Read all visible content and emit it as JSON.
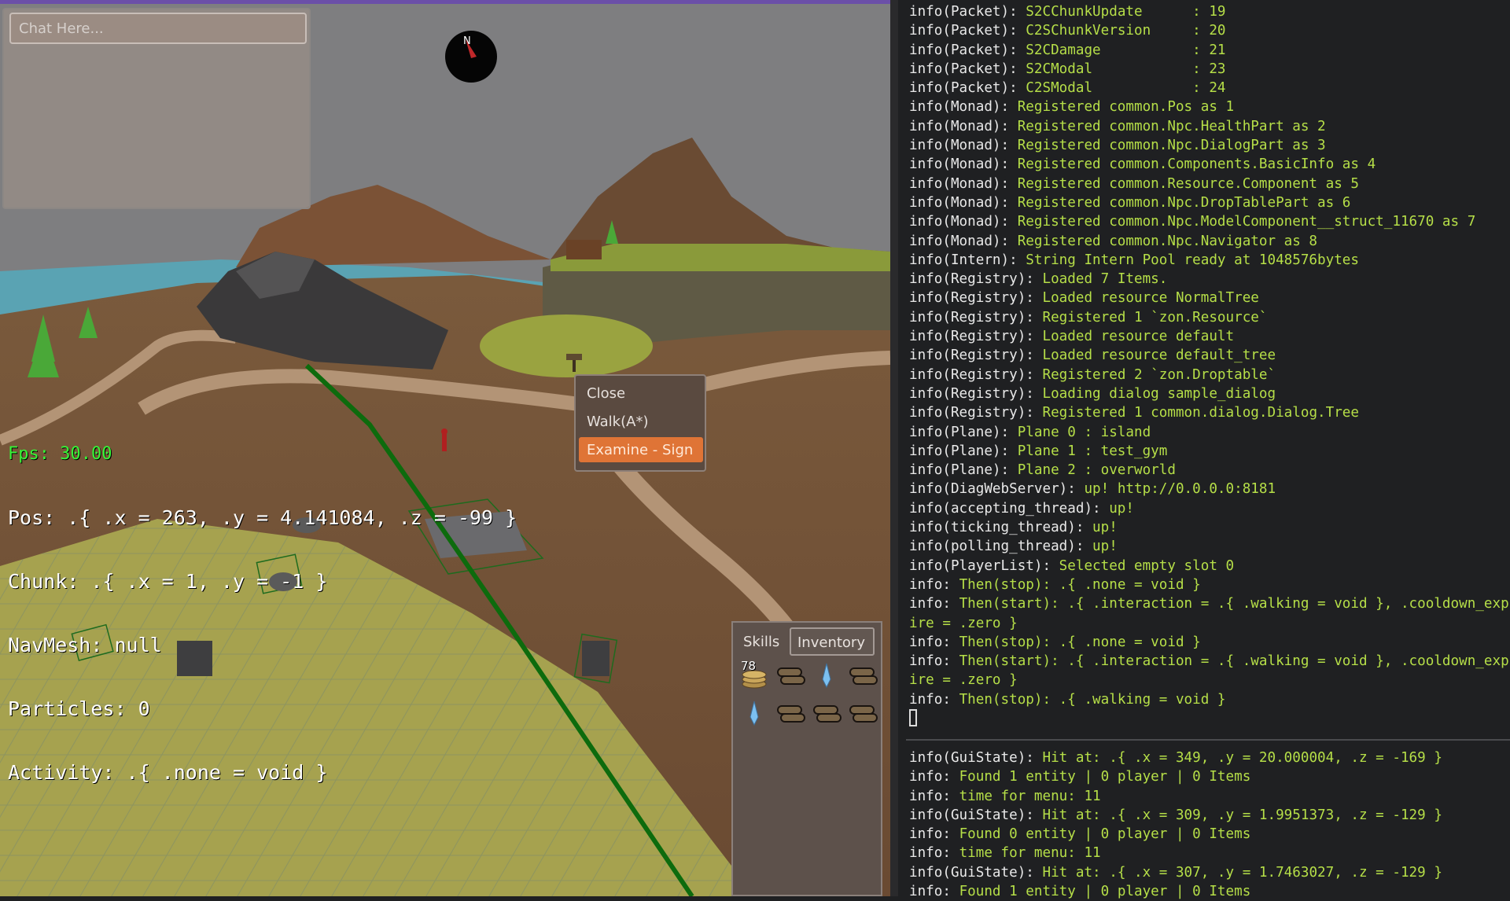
{
  "chat": {
    "placeholder": "Chat Here..."
  },
  "compass": {
    "north_label": "N"
  },
  "debug": {
    "fps": "Fps: 30.00",
    "pos": "Pos: .{ .x = 263, .y = 4.141084, .z = -99 }",
    "chunk": "Chunk: .{ .x = 1, .y = -1 }",
    "navmesh": "NavMesh: null",
    "particles": "Particles: 0",
    "activity": "Activity: .{ .none = void }"
  },
  "context_menu": {
    "items": [
      {
        "label": "Close"
      },
      {
        "label": "Walk(A*)"
      },
      {
        "label": "Examine - Sign"
      }
    ]
  },
  "side_panel": {
    "tabs": [
      "Skills",
      "Inventory"
    ],
    "active_tab": "Inventory",
    "slots": [
      {
        "icon": "coins-icon",
        "count": "78"
      },
      {
        "icon": "logs-icon",
        "count": ""
      },
      {
        "icon": "crystal-icon",
        "count": ""
      },
      {
        "icon": "logs-icon",
        "count": ""
      },
      {
        "icon": "crystal-icon",
        "count": ""
      },
      {
        "icon": "logs-icon",
        "count": ""
      },
      {
        "icon": "logs-icon",
        "count": ""
      },
      {
        "icon": "logs-icon",
        "count": ""
      }
    ]
  },
  "console_top": [
    {
      "tag": "info(Packet): ",
      "msg": "S2CChunkUpdate      : 19"
    },
    {
      "tag": "info(Packet): ",
      "msg": "C2SChunkVersion     : 20"
    },
    {
      "tag": "info(Packet): ",
      "msg": "S2CDamage           : 21"
    },
    {
      "tag": "info(Packet): ",
      "msg": "S2CModal            : 23"
    },
    {
      "tag": "info(Packet): ",
      "msg": "C2SModal            : 24"
    },
    {
      "tag": "info(Monad): ",
      "msg": "Registered common.Pos as 1"
    },
    {
      "tag": "info(Monad): ",
      "msg": "Registered common.Npc.HealthPart as 2"
    },
    {
      "tag": "info(Monad): ",
      "msg": "Registered common.Npc.DialogPart as 3"
    },
    {
      "tag": "info(Monad): ",
      "msg": "Registered common.Components.BasicInfo as 4"
    },
    {
      "tag": "info(Monad): ",
      "msg": "Registered common.Resource.Component as 5"
    },
    {
      "tag": "info(Monad): ",
      "msg": "Registered common.Npc.DropTablePart as 6"
    },
    {
      "tag": "info(Monad): ",
      "msg": "Registered common.Npc.ModelComponent__struct_11670 as 7"
    },
    {
      "tag": "info(Monad): ",
      "msg": "Registered common.Npc.Navigator as 8"
    },
    {
      "tag": "info(Intern): ",
      "msg": "String Intern Pool ready at 1048576bytes"
    },
    {
      "tag": "info(Registry): ",
      "msg": "Loaded 7 Items."
    },
    {
      "tag": "info(Registry): ",
      "msg": "Loaded resource NormalTree"
    },
    {
      "tag": "info(Registry): ",
      "msg": "Registered 1 `zon.Resource`"
    },
    {
      "tag": "info(Registry): ",
      "msg": "Loaded resource default"
    },
    {
      "tag": "info(Registry): ",
      "msg": "Loaded resource default_tree"
    },
    {
      "tag": "info(Registry): ",
      "msg": "Registered 2 `zon.Droptable`"
    },
    {
      "tag": "info(Registry): ",
      "msg": "Loading dialog sample_dialog"
    },
    {
      "tag": "info(Registry): ",
      "msg": "Registered 1 common.dialog.Dialog.Tree"
    },
    {
      "tag": "info(Plane): ",
      "msg": "Plane 0 : island"
    },
    {
      "tag": "info(Plane): ",
      "msg": "Plane 1 : test_gym"
    },
    {
      "tag": "info(Plane): ",
      "msg": "Plane 2 : overworld"
    },
    {
      "tag": "info(DiagWebServer): ",
      "msg": "up! http://0.0.0.0:8181"
    },
    {
      "tag": "info(accepting_thread): ",
      "msg": "up!"
    },
    {
      "tag": "info(ticking_thread): ",
      "msg": "up!"
    },
    {
      "tag": "info(polling_thread): ",
      "msg": "up!"
    },
    {
      "tag": "info(PlayerList): ",
      "msg": "Selected empty slot 0"
    },
    {
      "tag": "info: ",
      "msg": "Then(stop): .{ .none = void }"
    },
    {
      "tag": "info: ",
      "msg": "Then(start): .{ .interaction = .{ .walking = void }, .cooldown_exp"
    },
    {
      "tag": "",
      "msg": "ire = .zero }"
    },
    {
      "tag": "info: ",
      "msg": "Then(stop): .{ .none = void }"
    },
    {
      "tag": "info: ",
      "msg": "Then(start): .{ .interaction = .{ .walking = void }, .cooldown_exp"
    },
    {
      "tag": "",
      "msg": "ire = .zero }"
    },
    {
      "tag": "info: ",
      "msg": "Then(stop): .{ .walking = void }"
    }
  ],
  "console_bottom": [
    {
      "tag": "info(GuiState): ",
      "msg": "Hit at: .{ .x = 349, .y = 20.000004, .z = -169 }"
    },
    {
      "tag": "info: ",
      "msg": "Found 1 entity | 0 player | 0 Items"
    },
    {
      "tag": "info: ",
      "msg": "time for menu: 11"
    },
    {
      "tag": "info(GuiState): ",
      "msg": "Hit at: .{ .x = 309, .y = 1.9951373, .z = -129 }"
    },
    {
      "tag": "info: ",
      "msg": "Found 0 entity | 0 player | 0 Items"
    },
    {
      "tag": "info: ",
      "msg": "time for menu: 11"
    },
    {
      "tag": "info(GuiState): ",
      "msg": "Hit at: .{ .x = 307, .y = 1.7463027, .z = -129 }"
    },
    {
      "tag": "info: ",
      "msg": "Found 1 entity | 0 player | 0 Items"
    }
  ],
  "colors": {
    "console_bg": "#1f2022",
    "console_msg": "#b6df48",
    "fps_green": "#37f437",
    "menu_highlight": "#df7436"
  }
}
